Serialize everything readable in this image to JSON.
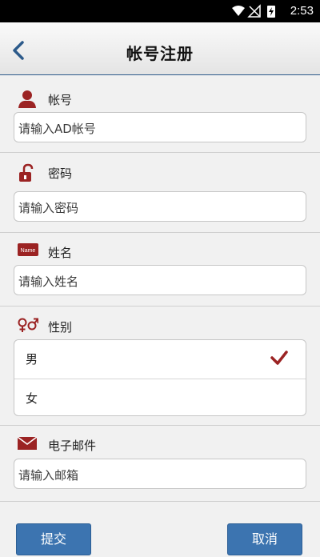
{
  "status_bar": {
    "time": "2:53"
  },
  "header": {
    "title": "帐号注册",
    "back_icon": "chevron-left-icon"
  },
  "account": {
    "label": "帐号",
    "icon": "user-icon",
    "placeholder": "请输入AD帐号"
  },
  "password": {
    "label": "密码",
    "icon": "lock-icon",
    "placeholder": "请输入密码"
  },
  "name": {
    "label": "姓名",
    "icon": "name-tag-icon",
    "icon_text": "Name",
    "placeholder": "请输入姓名"
  },
  "gender": {
    "label": "性别",
    "icon": "gender-icon",
    "options": [
      {
        "label": "男",
        "selected": true
      },
      {
        "label": "女",
        "selected": false
      }
    ]
  },
  "email": {
    "label": "电子邮件",
    "icon": "mail-icon",
    "placeholder": "请输入邮箱"
  },
  "actions": {
    "submit_label": "提交",
    "cancel_label": "取消"
  },
  "colors": {
    "accent": "#3c74b0",
    "icon_red": "#9b2323"
  }
}
